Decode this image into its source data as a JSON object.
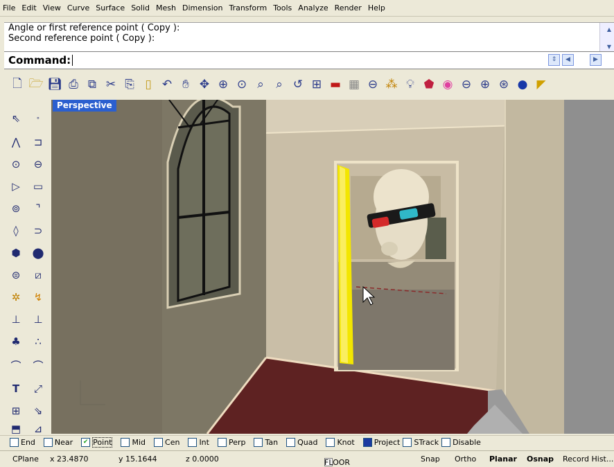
{
  "menu": [
    "File",
    "Edit",
    "View",
    "Curve",
    "Surface",
    "Solid",
    "Mesh",
    "Dimension",
    "Transform",
    "Tools",
    "Analyze",
    "Render",
    "Help"
  ],
  "history": {
    "line1": "Angle or first reference point ( Copy ):",
    "line2": "Second reference point ( Copy ):"
  },
  "command": {
    "label": "Command:",
    "value": ""
  },
  "viewport": {
    "label": "Perspective"
  },
  "osnaps": [
    {
      "label": "End",
      "checked": false
    },
    {
      "label": "Near",
      "checked": false
    },
    {
      "label": "Point",
      "checked": true
    },
    {
      "label": "Mid",
      "checked": false
    },
    {
      "label": "Cen",
      "checked": false
    },
    {
      "label": "Int",
      "checked": false
    },
    {
      "label": "Perp",
      "checked": false
    },
    {
      "label": "Tan",
      "checked": false
    },
    {
      "label": "Quad",
      "checked": false
    },
    {
      "label": "Knot",
      "checked": false
    },
    {
      "label": "Project",
      "checked": true
    },
    {
      "label": "STrack",
      "checked": false
    },
    {
      "label": "Disable",
      "checked": false
    }
  ],
  "status": {
    "cplane": "CPlane",
    "x": "x 23.4870",
    "y": "y 15.1644",
    "z": "z 0.0000",
    "layer": "FLOOR",
    "snap": "Snap",
    "ortho": "Ortho",
    "planar": "Planar",
    "osnap": "Osnap",
    "record": "Record Hist..."
  },
  "colors": {
    "wall_left": "#7a7466",
    "wall_back": "#c6bca6",
    "floor": "#5e2222",
    "door_yellow": "#f3e600",
    "viewport_label_bg": "#2b5fcf"
  }
}
